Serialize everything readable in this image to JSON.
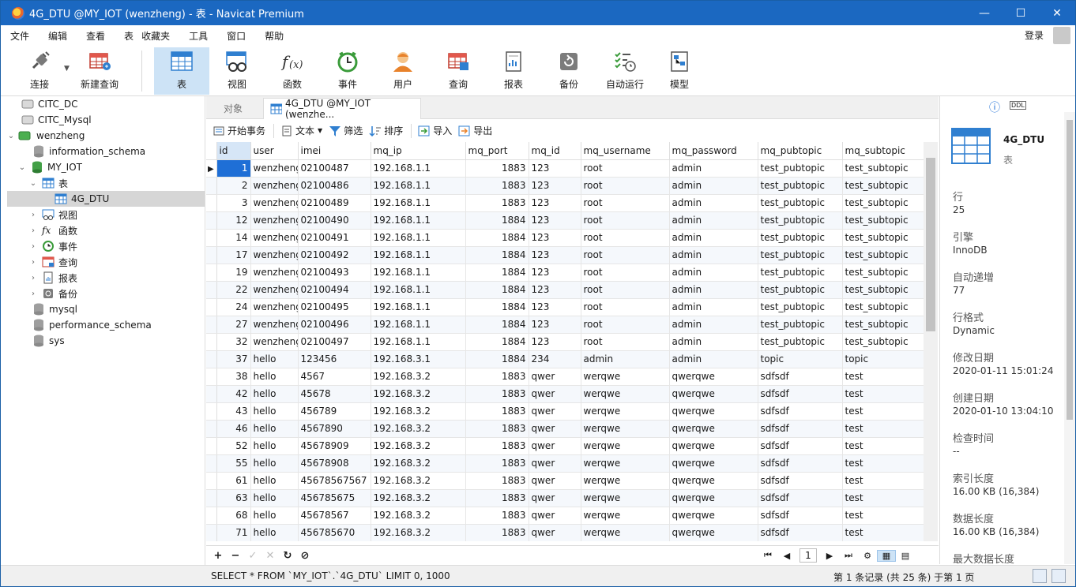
{
  "window": {
    "title": "4G_DTU @MY_IOT (wenzheng) - 表 - Navicat Premium"
  },
  "menu": [
    "文件",
    "编辑",
    "查看",
    "表",
    "收藏夹",
    "工具",
    "窗口",
    "帮助"
  ],
  "login": "登录",
  "toolbar": {
    "connect": "连接",
    "new_query": "新建查询",
    "table": "表",
    "view": "视图",
    "function": "函数",
    "event": "事件",
    "user": "用户",
    "query": "查询",
    "report": "报表",
    "backup": "备份",
    "autorun": "自动运行",
    "model": "模型"
  },
  "tree": {
    "citc_dc": "CITC_DC",
    "citc_mysql": "CITC_Mysql",
    "wenzheng": "wenzheng",
    "information_schema": "information_schema",
    "my_iot": "MY_IOT",
    "tables": "表",
    "4g_dtu": "4G_DTU",
    "views": "视图",
    "functions": "函数",
    "events": "事件",
    "queries": "查询",
    "reports": "报表",
    "backups": "备份",
    "mysql": "mysql",
    "performance_schema": "performance_schema",
    "sys": "sys"
  },
  "tabs": {
    "objects": "对象",
    "active": "4G_DTU @MY_IOT (wenzhe..."
  },
  "subtoolbar": {
    "begin_tx": "开始事务",
    "text": "文本",
    "filter": "筛选",
    "sort": "排序",
    "import": "导入",
    "export": "导出"
  },
  "grid": {
    "columns": [
      "id",
      "user",
      "imei",
      "mq_ip",
      "mq_port",
      "mq_id",
      "mq_username",
      "mq_password",
      "mq_pubtopic",
      "mq_subtopic"
    ],
    "rows": [
      [
        "1",
        "wenzheng",
        "02100487",
        "192.168.1.1",
        "1883",
        "123",
        "root",
        "admin",
        "test_pubtopic",
        "test_subtopic"
      ],
      [
        "2",
        "wenzheng",
        "02100486",
        "192.168.1.1",
        "1883",
        "123",
        "root",
        "admin",
        "test_pubtopic",
        "test_subtopic"
      ],
      [
        "3",
        "wenzheng",
        "02100489",
        "192.168.1.1",
        "1883",
        "123",
        "root",
        "admin",
        "test_pubtopic",
        "test_subtopic"
      ],
      [
        "12",
        "wenzheng",
        "02100490",
        "192.168.1.1",
        "1884",
        "123",
        "root",
        "admin",
        "test_pubtopic",
        "test_subtopic"
      ],
      [
        "14",
        "wenzheng",
        "02100491",
        "192.168.1.1",
        "1884",
        "123",
        "root",
        "admin",
        "test_pubtopic",
        "test_subtopic"
      ],
      [
        "17",
        "wenzheng",
        "02100492",
        "192.168.1.1",
        "1884",
        "123",
        "root",
        "admin",
        "test_pubtopic",
        "test_subtopic"
      ],
      [
        "19",
        "wenzheng",
        "02100493",
        "192.168.1.1",
        "1884",
        "123",
        "root",
        "admin",
        "test_pubtopic",
        "test_subtopic"
      ],
      [
        "22",
        "wenzheng",
        "02100494",
        "192.168.1.1",
        "1884",
        "123",
        "root",
        "admin",
        "test_pubtopic",
        "test_subtopic"
      ],
      [
        "24",
        "wenzheng",
        "02100495",
        "192.168.1.1",
        "1884",
        "123",
        "root",
        "admin",
        "test_pubtopic",
        "test_subtopic"
      ],
      [
        "27",
        "wenzheng",
        "02100496",
        "192.168.1.1",
        "1884",
        "123",
        "root",
        "admin",
        "test_pubtopic",
        "test_subtopic"
      ],
      [
        "32",
        "wenzheng",
        "02100497",
        "192.168.1.1",
        "1884",
        "123",
        "root",
        "admin",
        "test_pubtopic",
        "test_subtopic"
      ],
      [
        "37",
        "hello",
        "123456",
        "192.168.3.1",
        "1884",
        "234",
        "admin",
        "admin",
        "topic",
        "topic"
      ],
      [
        "38",
        "hello",
        "4567",
        "192.168.3.2",
        "1883",
        "qwer",
        "werqwe",
        "qwerqwe",
        "sdfsdf",
        "test"
      ],
      [
        "42",
        "hello",
        "45678",
        "192.168.3.2",
        "1883",
        "qwer",
        "werqwe",
        "qwerqwe",
        "sdfsdf",
        "test"
      ],
      [
        "43",
        "hello",
        "456789",
        "192.168.3.2",
        "1883",
        "qwer",
        "werqwe",
        "qwerqwe",
        "sdfsdf",
        "test"
      ],
      [
        "46",
        "hello",
        "4567890",
        "192.168.3.2",
        "1883",
        "qwer",
        "werqwe",
        "qwerqwe",
        "sdfsdf",
        "test"
      ],
      [
        "52",
        "hello",
        "45678909",
        "192.168.3.2",
        "1883",
        "qwer",
        "werqwe",
        "qwerqwe",
        "sdfsdf",
        "test"
      ],
      [
        "55",
        "hello",
        "45678908",
        "192.168.3.2",
        "1883",
        "qwer",
        "werqwe",
        "qwerqwe",
        "sdfsdf",
        "test"
      ],
      [
        "61",
        "hello",
        "45678567567",
        "192.168.3.2",
        "1883",
        "qwer",
        "werqwe",
        "qwerqwe",
        "sdfsdf",
        "test"
      ],
      [
        "63",
        "hello",
        "456785675",
        "192.168.3.2",
        "1883",
        "qwer",
        "werqwe",
        "qwerqwe",
        "sdfsdf",
        "test"
      ],
      [
        "68",
        "hello",
        "45678567",
        "192.168.3.2",
        "1883",
        "qwer",
        "werqwe",
        "qwerqwe",
        "sdfsdf",
        "test"
      ],
      [
        "71",
        "hello",
        "456785670",
        "192.168.3.2",
        "1883",
        "qwer",
        "werqwe",
        "qwerqwe",
        "sdfsdf",
        "test"
      ]
    ]
  },
  "pager": {
    "page": "1"
  },
  "info": {
    "name": "4G_DTU",
    "type": "表",
    "rows_label": "行",
    "rows_value": "25",
    "engine_label": "引擎",
    "engine_value": "InnoDB",
    "autoinc_label": "自动递增",
    "autoinc_value": "77",
    "rowformat_label": "行格式",
    "rowformat_value": "Dynamic",
    "modified_label": "修改日期",
    "modified_value": "2020-01-11 15:01:24",
    "created_label": "创建日期",
    "created_value": "2020-01-10 13:04:10",
    "checked_label": "检查时间",
    "checked_value": "--",
    "indexlen_label": "索引长度",
    "indexlen_value": "16.00 KB (16,384)",
    "datalen_label": "数据长度",
    "datalen_value": "16.00 KB (16,384)",
    "maxdata_label": "最大数据长度"
  },
  "status": {
    "sql": "SELECT * FROM `MY_IOT`.`4G_DTU` LIMIT 0, 1000",
    "records": "第 1 条记录 (共 25 条) 于第 1 页"
  },
  "colors": {
    "titlebar": "#1b68c1",
    "selected": "#cde3f6",
    "row_select": "#1f6fd6"
  }
}
